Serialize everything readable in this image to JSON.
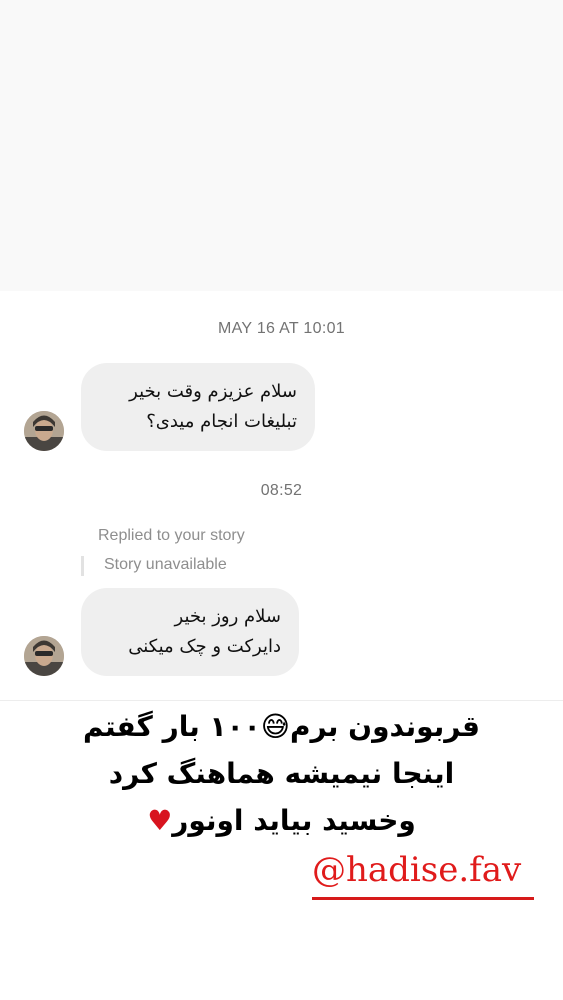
{
  "thread": {
    "timestamp_1": "MAY 16 AT 10:01",
    "message_1": {
      "line_1": "سلام عزیزم وقت بخیر",
      "line_2": "تبلیغات انجام میدی؟"
    },
    "timestamp_2": "08:52",
    "story_reply": {
      "label": "Replied to your story",
      "status": "Story unavailable"
    },
    "message_2": {
      "line_1": "سلام روز بخیر",
      "line_2": "دایرکت و چک میکنی"
    }
  },
  "overlay_text": {
    "line_1_a": "قربوندون برم",
    "line_1_emoji": "😅",
    "line_1_b": "۱۰۰ بار گفتم",
    "line_2": "اینجا نیمیشه  هماهنگ کرد",
    "line_3": "وخسید بیاید اونور",
    "heart": "♥"
  },
  "handle": "@hadise.fav",
  "colors": {
    "bubble": "#efefef",
    "timestamp": "#737373",
    "handle": "#e01b1b",
    "heart": "#d8141f"
  },
  "icons": {
    "avatar": "avatar-image",
    "heart": "heart-icon",
    "emoji": "grinning-sweat-emoji"
  }
}
